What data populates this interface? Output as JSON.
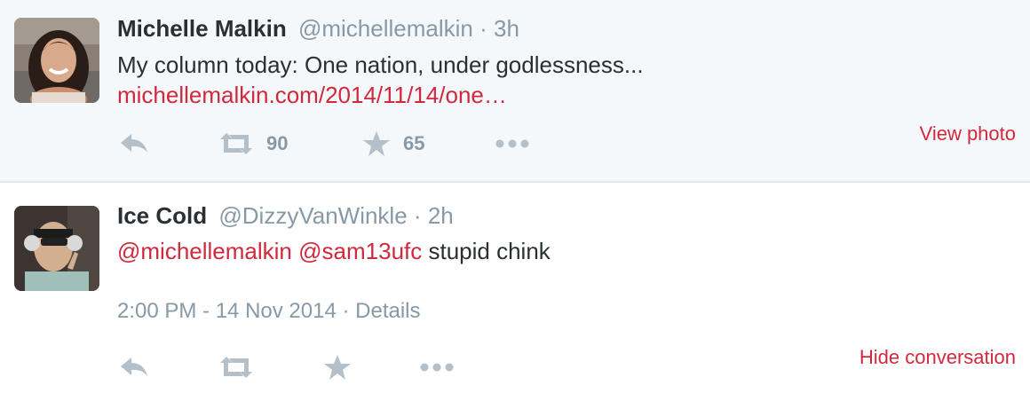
{
  "tweets": [
    {
      "fullname": "Michelle Malkin",
      "username": "@michellemalkin",
      "separator": "·",
      "time": "3h",
      "text": "My column today: One nation, under godlessness...",
      "link": "michellemalkin.com/2014/11/14/one…",
      "retweets": "90",
      "favorites": "65",
      "side_link": "View photo",
      "avatar_icon": "avatar-photo"
    },
    {
      "fullname": "Ice Cold",
      "username": "@DizzyVanWinkle",
      "separator": "·",
      "time": "2h",
      "mention1": "@michellemalkin",
      "mention2": "@sam13ufc",
      "text_rest": " stupid chink",
      "timestamp": "2:00 PM - 14 Nov 2014",
      "meta_separator": "·",
      "details": "Details",
      "side_link": "Hide conversation",
      "avatar_icon": "avatar-photo"
    }
  ],
  "icons": {
    "reply": "reply-icon",
    "retweet": "retweet-icon",
    "favorite": "star-icon",
    "more": "more-dots-icon"
  },
  "colors": {
    "link": "#d0293d",
    "muted": "#8899a6",
    "text": "#292f33",
    "highlight_bg": "#f5f8fa",
    "icon": "#b4c0c9"
  }
}
